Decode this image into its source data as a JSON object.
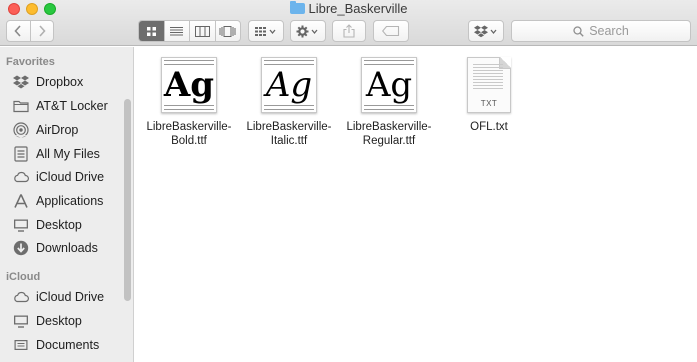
{
  "window": {
    "title": "Libre_Baskerville"
  },
  "toolbar": {
    "search_placeholder": "Search",
    "buttons": [
      {
        "name": "back-button",
        "icon": "chevron-left-icon"
      },
      {
        "name": "forward-button",
        "icon": "chevron-right-icon"
      },
      {
        "name": "icon-view-button",
        "icon": "grid-icon",
        "active": true
      },
      {
        "name": "list-view-button",
        "icon": "list-icon"
      },
      {
        "name": "column-view-button",
        "icon": "columns-icon"
      },
      {
        "name": "coverflow-view-button",
        "icon": "coverflow-icon"
      },
      {
        "name": "arrange-button",
        "icon": "arrange-icon"
      },
      {
        "name": "action-button",
        "icon": "gear-icon"
      },
      {
        "name": "share-button",
        "icon": "share-icon"
      },
      {
        "name": "tag-button",
        "icon": "tag-icon"
      },
      {
        "name": "dropbox-button",
        "icon": "dropbox-icon"
      }
    ]
  },
  "sidebar": {
    "sections": [
      {
        "title": "Favorites",
        "items": [
          {
            "label": "Dropbox",
            "icon": "dropbox-icon"
          },
          {
            "label": "AT&T Locker",
            "icon": "folder-icon"
          },
          {
            "label": "AirDrop",
            "icon": "airdrop-icon"
          },
          {
            "label": "All My Files",
            "icon": "all-files-icon"
          },
          {
            "label": "iCloud Drive",
            "icon": "cloud-icon"
          },
          {
            "label": "Applications",
            "icon": "applications-icon"
          },
          {
            "label": "Desktop",
            "icon": "desktop-icon"
          },
          {
            "label": "Downloads",
            "icon": "downloads-icon"
          }
        ]
      },
      {
        "title": "iCloud",
        "items": [
          {
            "label": "iCloud Drive",
            "icon": "cloud-icon"
          },
          {
            "label": "Desktop",
            "icon": "desktop-icon"
          },
          {
            "label": "Documents",
            "icon": "documents-icon"
          }
        ]
      }
    ]
  },
  "files": [
    {
      "line1": "LibreBaskerville-",
      "line2": "Bold.ttf",
      "preview": "Ag",
      "style": "bold"
    },
    {
      "line1": "LibreBaskerville-",
      "line2": "Italic.ttf",
      "preview": "Ag",
      "style": "italic"
    },
    {
      "line1": "LibreBaskerville-",
      "line2": "Regular.ttf",
      "preview": "Ag",
      "style": "regular"
    },
    {
      "line1": "OFL.txt",
      "line2": "",
      "preview": "TXT",
      "style": "text"
    }
  ],
  "colors": {
    "accent": "#6cb4ec",
    "sidebar_bg": "#ededed",
    "close": "#fc5f57",
    "minimize": "#fdbc2e",
    "maximize": "#29c840"
  }
}
